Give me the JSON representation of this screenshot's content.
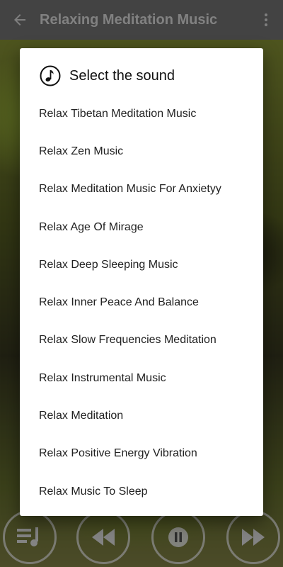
{
  "app_bar": {
    "title": "Relaxing Meditation Music",
    "back_icon": "arrow-back-icon",
    "menu_icon": "more-vert-icon"
  },
  "dialog": {
    "icon": "music-note-icon",
    "title": "Select the sound",
    "options": [
      "Relax Tibetan Meditation Music",
      "Relax Zen Music",
      "Relax Meditation Music For Anxietyy",
      "Relax Age Of Mirage",
      "Relax Deep Sleeping Music",
      "Relax Inner Peace And Balance",
      "Relax Slow Frequencies Meditation",
      "Relax Instrumental Music",
      "Relax Meditation",
      "Relax Positive Energy Vibration",
      "Relax Music To Sleep"
    ]
  },
  "controls": {
    "playlist_icon": "playlist-icon",
    "rewind_icon": "rewind-icon",
    "pause_icon": "pause-icon",
    "forward_icon": "fast-forward-icon"
  }
}
